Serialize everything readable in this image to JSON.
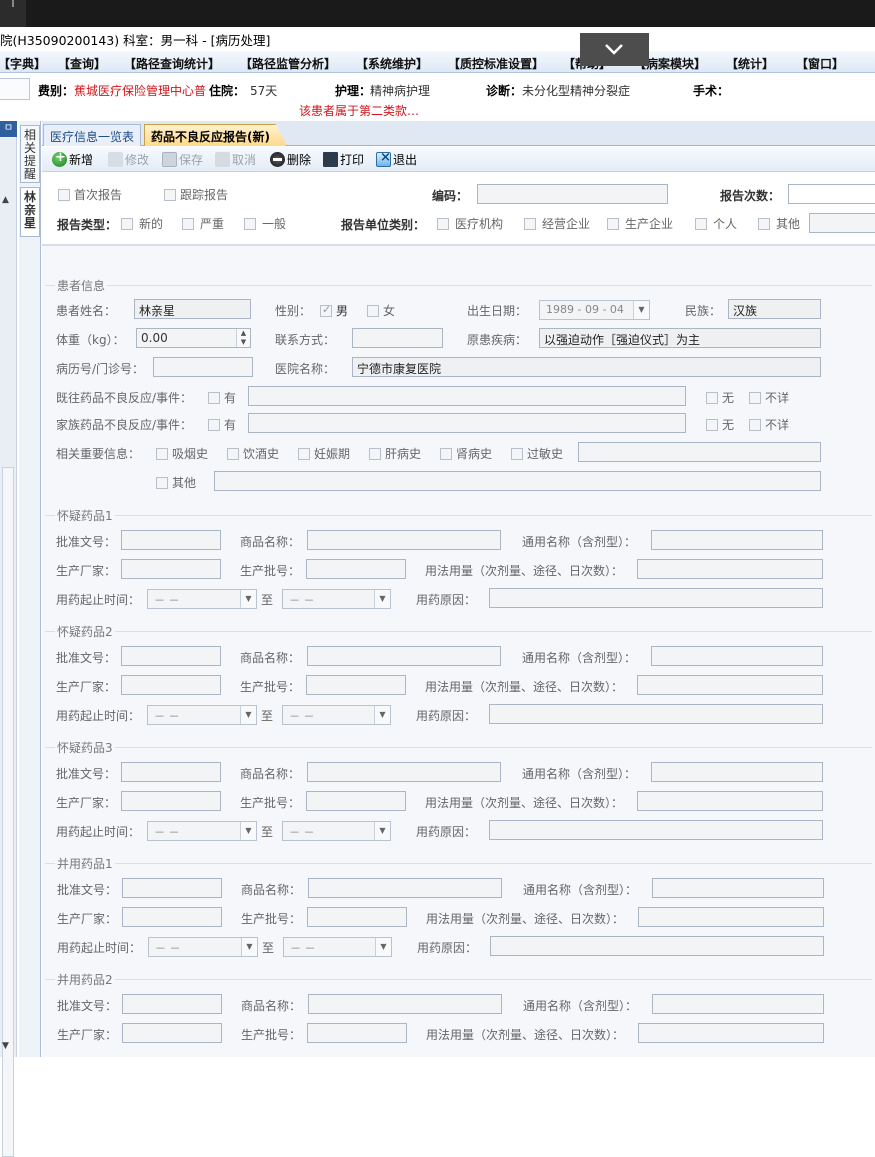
{
  "titlebar": {
    "title": "院(H35090200143) 科室：男一科 - [病历处理]"
  },
  "menu": [
    "【字典】",
    "【查询】",
    "【路径查询统计】",
    "【路径监管分析】",
    "【系统维护】",
    "【质控标准设置】",
    "【帮助】",
    "【病案模块】",
    "【统计】",
    "【窗口】"
  ],
  "patient_bar": {
    "category_label": "费别：",
    "category_value": "蕉城医疗保险管理中心普",
    "stay_label": "住院：",
    "stay_value": "57天",
    "nursing_label": "护理：",
    "nursing_value": "精神病护理",
    "diagnosis_label": "诊断：",
    "diagnosis_value": "未分化型精神分裂症",
    "surgery_label": "手术：",
    "warning": "该患者属于第二类款…"
  },
  "side": {
    "pin": "ㅁ",
    "tab1": "相关提醒",
    "tab2": "林亲星"
  },
  "tabs": [
    {
      "label": "医疗信息一览表"
    },
    {
      "label": "药品不良反应报告(新)"
    }
  ],
  "toolbar": {
    "add": "新增",
    "edit": "修改",
    "save": "保存",
    "cancel": "取消",
    "delete": "删除",
    "print": "打印",
    "exit": "退出"
  },
  "report": {
    "first_report": "首次报告",
    "follow_report": "跟踪报告",
    "code_label": "编码：",
    "count_label": "报告次数：",
    "type_label": "报告类型：",
    "type_options": [
      "新的",
      "严重",
      "一般"
    ],
    "unit_label": "报告单位类别：",
    "unit_options": [
      "医疗机构",
      "经营企业",
      "生产企业",
      "个人",
      "其他"
    ]
  },
  "patient": {
    "section": "患者信息",
    "name_label": "患者姓名：",
    "name_value": "林亲星",
    "gender_label": "性别：",
    "male": "男",
    "female": "女",
    "dob_label": "出生日期：",
    "dob_value": "1989 - 09 - 04",
    "ethnic_label": "民族：",
    "ethnic_value": "汉族",
    "weight_label": "体重（kg）：",
    "weight_value": "0.00",
    "contact_label": "联系方式：",
    "disease_label": "原患疾病：",
    "disease_value": "以强迫动作［强迫仪式］为主",
    "record_label": "病历号/门诊号：",
    "hospital_label": "医院名称：",
    "hospital_value": "宁德市康复医院",
    "past_label": "既往药品不良反应/事件：",
    "family_label": "家族药品不良反应/事件：",
    "yes": "有",
    "no": "无",
    "unknown": "不详",
    "related_label": "相关重要信息：",
    "related_options": [
      "吸烟史",
      "饮酒史",
      "妊娠期",
      "肝病史",
      "肾病史",
      "过敏史"
    ],
    "other": "其他"
  },
  "drug_labels": {
    "approval": "批准文号：",
    "product": "商品名称：",
    "generic": "通用名称（含剂型）：",
    "maker": "生产厂家：",
    "batch": "生产批号：",
    "usage": "用法用量（次剂量、途径、日次数）：",
    "period": "用药起止时间：",
    "to": "至",
    "reason": "用药原因：",
    "date_placeholder": "－  －"
  },
  "drug_groups": [
    "怀疑药品1",
    "怀疑药品2",
    "怀疑药品3",
    "并用药品1",
    "并用药品2"
  ]
}
